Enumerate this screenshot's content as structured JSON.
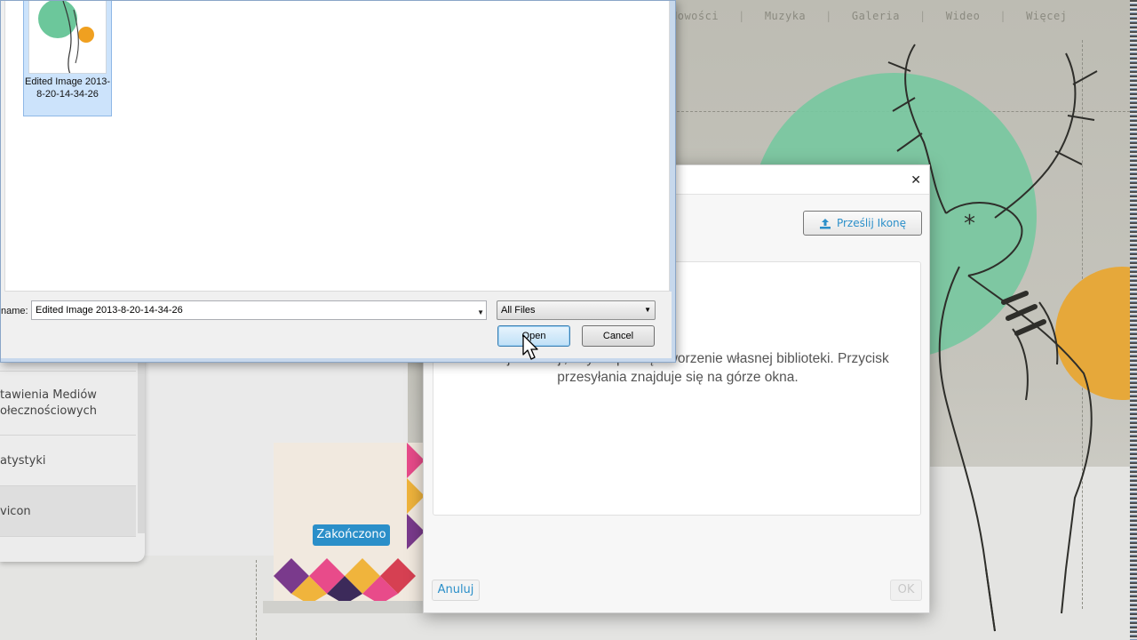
{
  "site": {
    "nav": [
      "Nowości",
      "Muzyka",
      "Galeria",
      "Wideo",
      "Więcej"
    ],
    "menu": [
      {
        "label": "tawienia Mediów ołecznościowych"
      },
      {
        "label": "atystyki"
      },
      {
        "label": "vicon"
      }
    ],
    "done_button": "Zakończono"
  },
  "modal": {
    "upload_button": "Prześlij Ikonę",
    "info_text": ". Kliknij 'Prześlij', aby rozpocząć tworzenie własnej biblioteki. Przycisk przesyłania znajduje się na górze okna.",
    "cancel_button": "Anuluj",
    "ok_button": "OK"
  },
  "file_dialog": {
    "file_tile_label": "Edited Image 2013-8-20-14-34-26",
    "filename_label": "name:",
    "filename_value": "Edited Image 2013-8-20-14-34-26",
    "filter_value": "All Files",
    "open_button": "Open",
    "cancel_button": "Cancel"
  },
  "colors": {
    "accent_blue": "#2b8fc9",
    "deco_green": "#77c8a0",
    "deco_orange": "#e6a83a",
    "tile_selection": "#cce3fb"
  }
}
